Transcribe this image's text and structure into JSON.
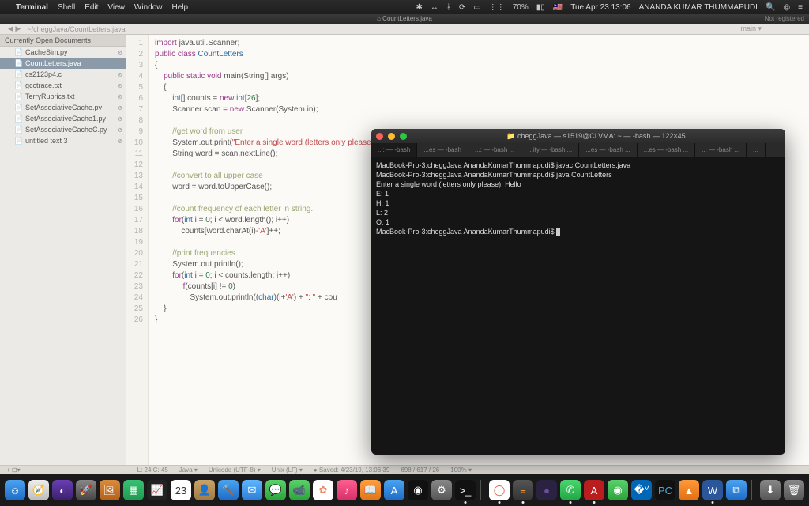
{
  "menubar": {
    "app": "Terminal",
    "items": [
      "Shell",
      "Edit",
      "View",
      "Window",
      "Help"
    ],
    "battery": "70%",
    "flag": "🇲🇾",
    "clock": "Tue Apr 23  13:06",
    "user": "ANANDA KUMAR THUMMAPUDI"
  },
  "editor": {
    "titlebar_center": "⌂ CountLetters.java",
    "not_registered": "Not registered",
    "pathbar_left": "◀ ▶",
    "pathbar_path": "~/cheggJava/CountLetters.java",
    "pathbar_main": "main ▾",
    "sidebar": {
      "header": "Currently Open Documents",
      "items": [
        {
          "label": "CacheSim.py",
          "kind": "py"
        },
        {
          "label": "CountLetters.java",
          "kind": "java",
          "sel": true
        },
        {
          "label": "cs2123p4.c",
          "kind": "c"
        },
        {
          "label": "gcctrace.txt",
          "kind": "txt"
        },
        {
          "label": "TerryRubrics.txt",
          "kind": "txt"
        },
        {
          "label": "SetAssociativeCache.py",
          "kind": "py"
        },
        {
          "label": "SetAssociativeCache1.py",
          "kind": "py"
        },
        {
          "label": "SetAssociativeCacheC.py",
          "kind": "py"
        },
        {
          "label": "untitled text 3",
          "kind": "txt"
        }
      ]
    },
    "code_lines": [
      {
        "n": 1,
        "html": "<span class='kw'>import</span> java.util.Scanner;"
      },
      {
        "n": 2,
        "html": "<span class='kw'>public class</span> <span class='ty'>CountLetters</span>"
      },
      {
        "n": 3,
        "html": "{"
      },
      {
        "n": 4,
        "html": "    <span class='kw'>public static void</span> main(String[] args)"
      },
      {
        "n": 5,
        "html": "    {"
      },
      {
        "n": 6,
        "html": "        <span class='ty'>int</span>[] counts = <span class='kw'>new</span> <span class='ty'>int</span>[<span class='num'>26</span>];"
      },
      {
        "n": 7,
        "html": "        Scanner scan = <span class='kw'>new</span> Scanner(System.in);"
      },
      {
        "n": 8,
        "html": ""
      },
      {
        "n": 9,
        "html": "        <span class='cmt'>//get word from user</span>"
      },
      {
        "n": 10,
        "html": "        System.out.print(<span class='str'>\"Enter a single word (letters only please): \"</span>);"
      },
      {
        "n": 11,
        "html": "        String word = scan.nextLine();"
      },
      {
        "n": 12,
        "html": ""
      },
      {
        "n": 13,
        "html": "        <span class='cmt'>//convert to all upper case</span>"
      },
      {
        "n": 14,
        "html": "        word = word.toUpperCase();"
      },
      {
        "n": 15,
        "html": ""
      },
      {
        "n": 16,
        "html": "        <span class='cmt'>//count frequency of each letter in string.</span>"
      },
      {
        "n": 17,
        "html": "        <span class='kw'>for</span>(<span class='ty'>int</span> i = <span class='num'>0</span>; i &lt; word.length(); i++)"
      },
      {
        "n": 18,
        "html": "            counts[word.charAt(i)-<span class='str'>'A'</span>]++;"
      },
      {
        "n": 19,
        "html": ""
      },
      {
        "n": 20,
        "html": "        <span class='cmt'>//print frequencies</span>"
      },
      {
        "n": 21,
        "html": "        System.out.println();"
      },
      {
        "n": 22,
        "html": "        <span class='kw'>for</span>(<span class='ty'>int</span> i = <span class='num'>0</span>; i &lt; counts.length; i++)"
      },
      {
        "n": 23,
        "html": "            <span class='kw'>if</span>(counts[i] != <span class='num'>0</span>)"
      },
      {
        "n": 24,
        "html": "                System.out.println((<span class='ty'>char</span>)(i+<span class='str'>'A'</span>) + <span class='str'>\": \"</span> + cou"
      },
      {
        "n": 25,
        "html": "    }"
      },
      {
        "n": 26,
        "html": "}"
      }
    ],
    "status": {
      "pos": "L: 24 C: 45",
      "lang": "Java ▾",
      "enc": "Unicode (UTF-8) ▾",
      "lineend": "Unix (LF) ▾",
      "modified": "● Saved: 4/23/19, 13:06:39",
      "size": "698 / 617 / 26",
      "zoom": "100% ▾"
    }
  },
  "terminal": {
    "title": "📁 cheggJava — s1519@CLVMA: ~ — -bash — 122×45",
    "tabs": [
      {
        "label": "...: — -bash",
        "active": true
      },
      {
        "label": "...es — -bash"
      },
      {
        "label": "...: — -bash ..."
      },
      {
        "label": "...ity — -bash ..."
      },
      {
        "label": "...es — -bash ..."
      },
      {
        "label": "...es — -bash ..."
      },
      {
        "label": "... — -bash ..."
      },
      {
        "label": "..."
      }
    ],
    "lines": [
      "MacBook-Pro-3:cheggJava AnandaKumarThummapudi$ javac CountLetters.java",
      "MacBook-Pro-3:cheggJava AnandaKumarThummapudi$ java CountLetters",
      "Enter a single word (letters only please): Hello",
      "",
      "E: 1",
      "H: 1",
      "L: 2",
      "O: 1",
      "MacBook-Pro-3:cheggJava AnandaKumarThummapudi$ "
    ]
  },
  "dock": {
    "icons": [
      {
        "name": "finder",
        "bg": "linear-gradient(#4aa3f0,#1e6bc6)",
        "g": "☺"
      },
      {
        "name": "safari",
        "bg": "linear-gradient(#eee,#bbb)",
        "g": "🧭"
      },
      {
        "name": "respondus",
        "bg": "linear-gradient(#6a3fb5,#3a1f6a)",
        "g": "◐"
      },
      {
        "name": "launchpad",
        "bg": "linear-gradient(#888,#444)",
        "g": "🚀"
      },
      {
        "name": "preview",
        "bg": "linear-gradient(#d98b3a,#b56018)",
        "g": "🖼"
      },
      {
        "name": "numbers",
        "bg": "linear-gradient(#38c172,#1f9a52)",
        "g": "▦"
      },
      {
        "name": "activity",
        "bg": "#222",
        "g": "📈"
      },
      {
        "name": "calendar",
        "bg": "#fff",
        "g": "23",
        "fg": "#333"
      },
      {
        "name": "contacts",
        "bg": "linear-gradient(#c9a36a,#a07a42)",
        "g": "👤"
      },
      {
        "name": "xcode",
        "bg": "linear-gradient(#4aa3f0,#1e6bc6)",
        "g": "🔨"
      },
      {
        "name": "mail",
        "bg": "linear-gradient(#5eb6ff,#2a7dd6)",
        "g": "✉"
      },
      {
        "name": "messages",
        "bg": "linear-gradient(#5ad16a,#2ba33b)",
        "g": "💬"
      },
      {
        "name": "facetime",
        "bg": "linear-gradient(#5ad16a,#2ba33b)",
        "g": "📹"
      },
      {
        "name": "photos",
        "bg": "#fff",
        "g": "✿",
        "fg": "#e86"
      },
      {
        "name": "itunes",
        "bg": "linear-gradient(#ff5f8f,#d62f6a)",
        "g": "♪"
      },
      {
        "name": "ibooks",
        "bg": "linear-gradient(#ff9f3f,#e07518)",
        "g": "📖"
      },
      {
        "name": "appstore",
        "bg": "linear-gradient(#4aa3f0,#1e6bc6)",
        "g": "A"
      },
      {
        "name": "siri",
        "bg": "#111",
        "g": "◉"
      },
      {
        "name": "sysprefs",
        "bg": "linear-gradient(#888,#555)",
        "g": "⚙"
      },
      {
        "name": "terminal",
        "bg": "#111",
        "g": ">_",
        "dot": true
      }
    ],
    "icons2": [
      {
        "name": "chrome",
        "bg": "#fff",
        "g": "◯",
        "fg": "#e25241",
        "dot": true
      },
      {
        "name": "sublime",
        "bg": "linear-gradient(#555,#333)",
        "g": "≡",
        "fg": "#ff9f3f",
        "dot": true
      },
      {
        "name": "eclipse",
        "bg": "#2b2140",
        "g": "●",
        "fg": "#6a4fa0"
      },
      {
        "name": "whatsapp",
        "bg": "linear-gradient(#4ad66d,#1fa647)",
        "g": "✆",
        "dot": true
      },
      {
        "name": "acrobat",
        "bg": "#b91d1d",
        "g": "A",
        "dot": true
      },
      {
        "name": "anaconda",
        "bg": "linear-gradient(#5ad16a,#2ba33b)",
        "g": "◉"
      },
      {
        "name": "vscode",
        "bg": "#0066b8",
        "g": "�ⱽ"
      },
      {
        "name": "pycharm",
        "bg": "#111",
        "g": "PC",
        "fg": "#4ad"
      },
      {
        "name": "vlc",
        "bg": "linear-gradient(#ff9a3a,#e06f12)",
        "g": "▲"
      },
      {
        "name": "word",
        "bg": "#2b579a",
        "g": "W",
        "dot": true
      },
      {
        "name": "vm",
        "bg": "linear-gradient(#4aa3f0,#1e6bc6)",
        "g": "⧉"
      }
    ],
    "icons3": [
      {
        "name": "downloads",
        "bg": "linear-gradient(#888,#555)",
        "g": "⬇"
      },
      {
        "name": "trash",
        "bg": "linear-gradient(#888,#555)",
        "g": "🗑"
      }
    ]
  }
}
